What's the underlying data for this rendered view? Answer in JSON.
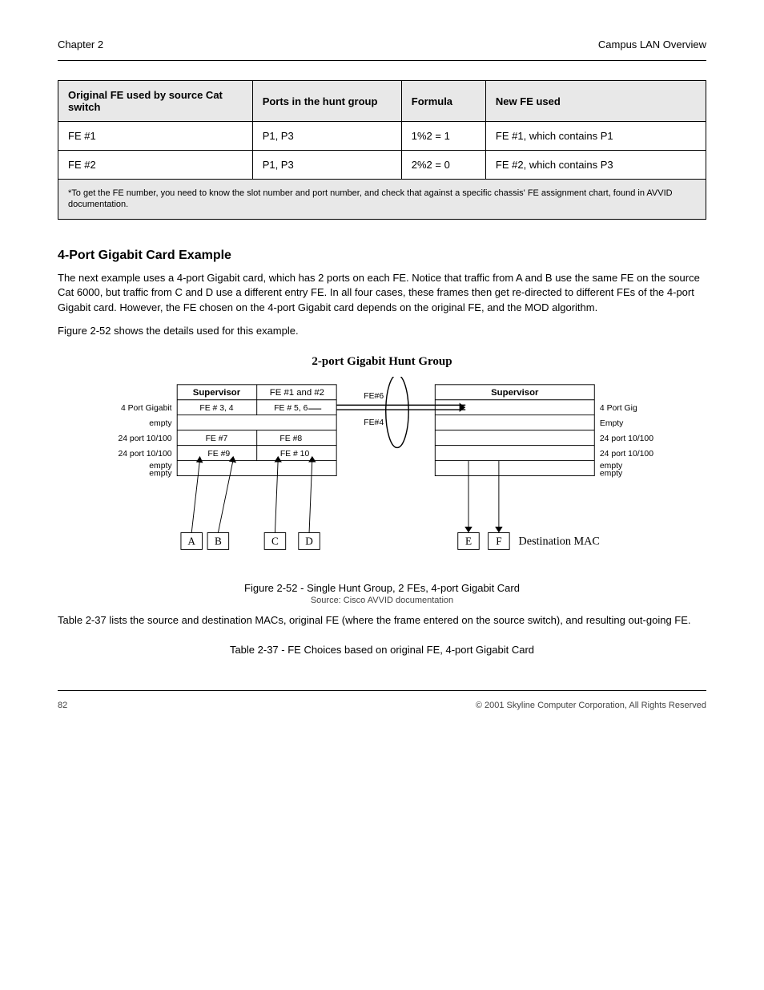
{
  "page_header": {
    "left": "Chapter 2",
    "right": "Campus LAN Overview"
  },
  "table": {
    "headers": [
      "Original FE used by source Cat switch",
      "Ports in the hunt group",
      "Formula",
      "New FE used"
    ],
    "rows": [
      {
        "fe_src": "FE #1",
        "ports": "P1, P3",
        "formula": "1%2 = 1",
        "fe_new": "FE #1, which contains P1"
      },
      {
        "fe_src": "FE #2",
        "ports": "P1, P3",
        "formula": "2%2 = 0",
        "fe_new": "FE #2, which contains P3"
      }
    ],
    "note": "*To get the FE number, you need to know the slot number and port number, and check that against a specific chassis' FE assignment chart, found in AVVID documentation."
  },
  "section_title": "4-Port Gigabit Card Example",
  "paragraphs": [
    "The next example uses a 4-port Gigabit card, which has 2 ports on each FE. Notice that traffic from A and B use the same FE on the source Cat 6000, but traffic from C and D use a different entry FE. In all four cases, these frames then get re-directed to different FEs of the 4-port Gigabit card. However, the FE chosen on the 4-port Gigabit card depends on the original FE, and the MOD algorithm.",
    "Figure 2-52 shows the details used for this example."
  ],
  "figure": {
    "title": "2-port Gigabit Hunt Group",
    "caption": "Figure 2-52 - Single Hunt Group, 2 FEs, 4-port Gigabit Card",
    "footnote_label": "Source: Cisco AVVID documentation",
    "left_switch": {
      "header_left": "Supervisor",
      "header_right": "FE #1 and #2",
      "slots": [
        "4 Port Gigabit",
        "empty",
        "24 port 10/100",
        "24 port 10/100",
        "empty",
        "empty"
      ],
      "row1_left": "FE # 3, 4",
      "row1_right": "FE # 5, 6",
      "row3_left": "FE #7",
      "row3_right": "FE #8",
      "row4_left": "FE #9",
      "row4_right": "FE # 10"
    },
    "right_switch": {
      "header": "Supervisor",
      "slots": [
        "4 Port Gig",
        "Empty",
        "24 port 10/100",
        "24 port 10/100",
        "empty",
        "empty"
      ]
    },
    "link_top": "FE#6",
    "link_bot": "FE#4",
    "macs_left": [
      "A",
      "B",
      "C",
      "D"
    ],
    "macs_right": [
      "E",
      "F"
    ],
    "dest_label": "Destination MAC"
  },
  "after_figure": "Table 2-37 lists the source and destination MACs, original FE (where the frame entered on the source switch), and resulting out-going FE.",
  "table2_caption": "Table 2-37 - FE Choices based on original FE, 4-port Gigabit Card",
  "footer": {
    "page": "82",
    "copyright": "© 2001 Skyline Computer Corporation, All Rights Reserved"
  }
}
